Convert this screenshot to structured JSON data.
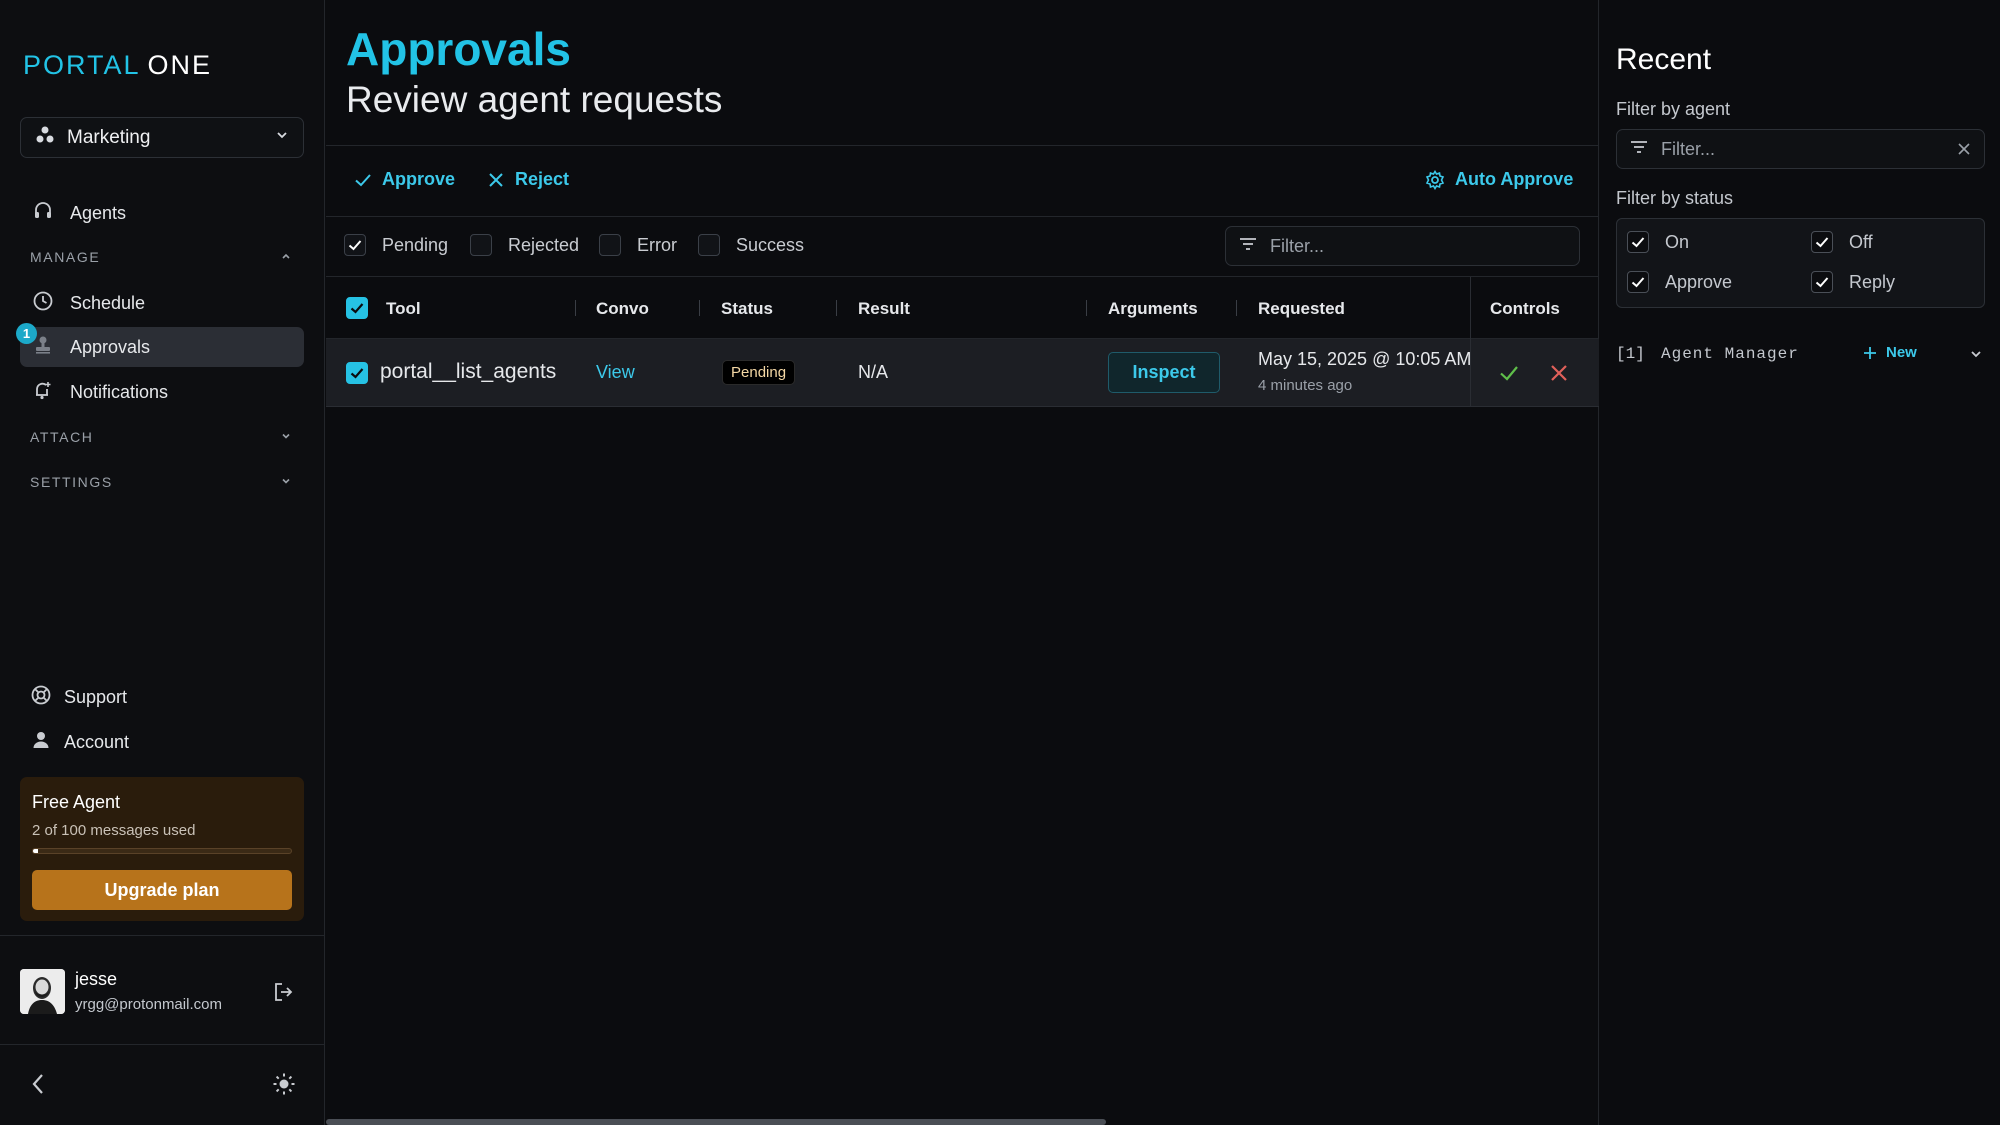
{
  "app": {
    "logo_part1": "PORTAL",
    "logo_part2": "ONE"
  },
  "sidebar": {
    "workspace": "Marketing",
    "agents_label": "Agents",
    "manage_label": "MANAGE",
    "schedule_label": "Schedule",
    "approvals_label": "Approvals",
    "approvals_badge": "1",
    "notifications_label": "Notifications",
    "attach_label": "ATTACH",
    "settings_label": "SETTINGS",
    "support_label": "Support",
    "account_label": "Account",
    "plan": {
      "title": "Free Agent",
      "usage_text": "2 of 100 messages used",
      "usage_fraction": 0.02,
      "upgrade_label": "Upgrade plan"
    },
    "user": {
      "name": "jesse",
      "email": "yrgg@protonmail.com"
    }
  },
  "main": {
    "title": "Approvals",
    "subtitle": "Review agent requests",
    "toolbar": {
      "approve_label": "Approve",
      "reject_label": "Reject",
      "auto_approve_label": "Auto Approve"
    },
    "status_filters": [
      {
        "label": "Pending",
        "checked": true
      },
      {
        "label": "Rejected",
        "checked": false
      },
      {
        "label": "Error",
        "checked": false
      },
      {
        "label": "Success",
        "checked": false
      }
    ],
    "filter_placeholder": "Filter...",
    "columns": {
      "tool": "Tool",
      "convo": "Convo",
      "status": "Status",
      "result": "Result",
      "arguments": "Arguments",
      "requested": "Requested",
      "controls": "Controls"
    },
    "rows": [
      {
        "tool": "portal__list_agents",
        "convo": "View",
        "status": "Pending",
        "result": "N/A",
        "arguments_button": "Inspect",
        "requested": "May 15, 2025 @ 10:05 AM",
        "requested_relative": "4 minutes ago"
      }
    ]
  },
  "right_panel": {
    "title": "Recent",
    "filter_agent_label": "Filter by agent",
    "filter_placeholder": "Filter...",
    "filter_status_label": "Filter by status",
    "statuses": [
      {
        "label": "On",
        "checked": true
      },
      {
        "label": "Off",
        "checked": true
      },
      {
        "label": "Approve",
        "checked": true
      },
      {
        "label": "Reply",
        "checked": true
      }
    ],
    "agent_index": "[1]",
    "agent_name": "Agent Manager",
    "new_label": "New"
  },
  "colors": {
    "accent": "#22c3e6",
    "plan_bg": "#2a1c0c",
    "upgrade": "#b7731b",
    "approve_check": "#5fbf4a",
    "reject_x": "#e0605a"
  }
}
